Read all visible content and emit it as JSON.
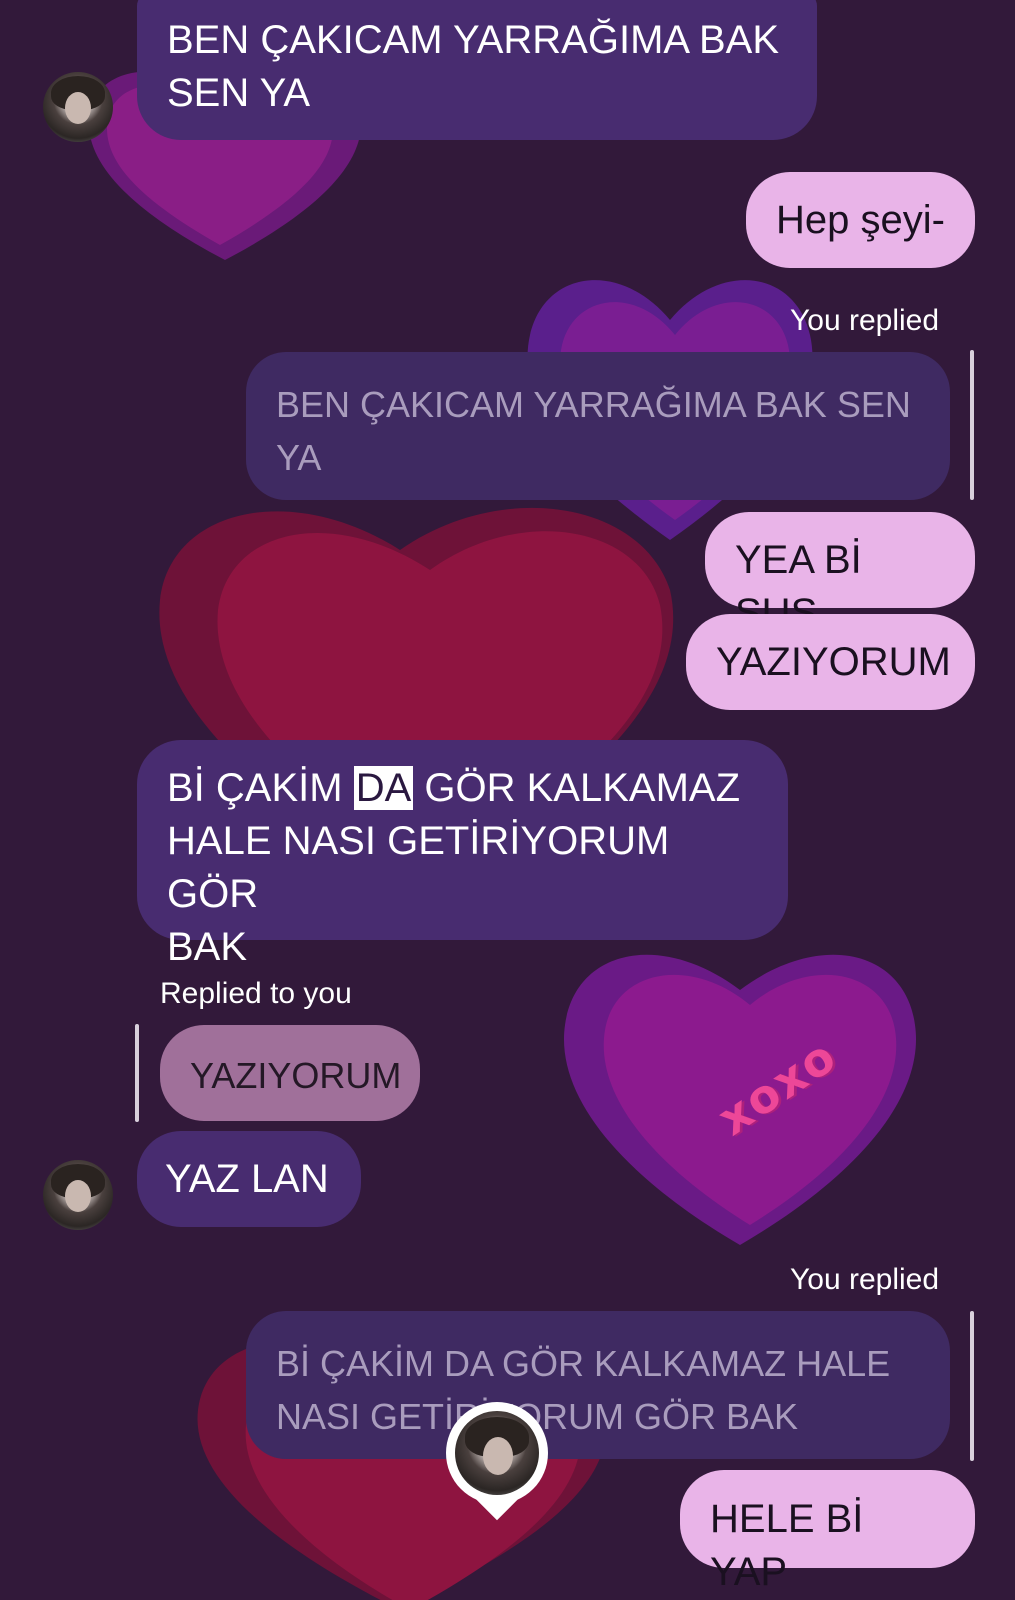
{
  "colors": {
    "background": "#32193a",
    "received_bubble": "#482c70",
    "sent_bubble": "#e9b4e8",
    "quoted_bubble": "#3f2a62",
    "heart_purple": "#8a1a8c",
    "heart_red": "#8e1440"
  },
  "decorations": {
    "xoxo_text": "xoxo"
  },
  "messages": {
    "m1_text": "BEN ÇAKICAM YARRAĞIMA BAK\nSEN YA",
    "m2_text": "Hep şeyi-",
    "m3_meta": "You replied",
    "m3_quote": "BEN ÇAKICAM YARRAĞIMA BAK SEN\nYA",
    "m4_text": "YEA Bİ SUS",
    "m5_text": "YAZIYORUM",
    "m6_before": "Bİ ÇAKİM ",
    "m6_highlight": "DA",
    "m6_after": " GÖR KALKAMAZ\nHALE NASI GETİRİYORUM GÖR\nBAK",
    "m7_meta": "Replied to you",
    "m7_quote": "YAZIYORUM",
    "m8_text": "YAZ LAN",
    "m9_meta": "You replied",
    "m9_quote": "Bİ ÇAKİM DA GÖR KALKAMAZ HALE\nNASI GETİRİYORUM GÖR BAK",
    "m10_text": "HELE Bİ YAP"
  }
}
